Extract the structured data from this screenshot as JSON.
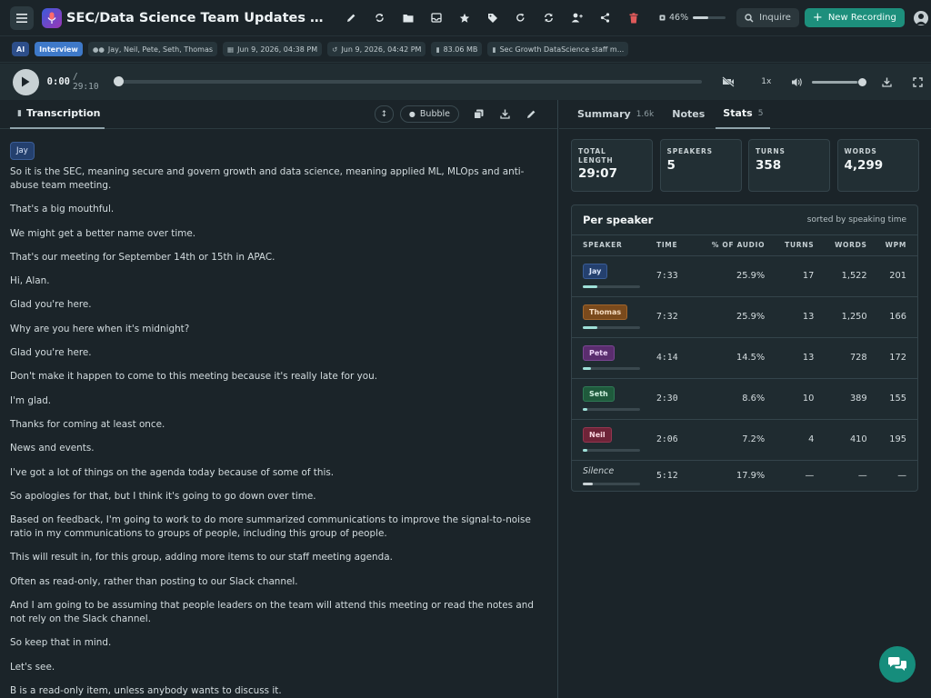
{
  "header": {
    "title": "SEC/Data Science Team Updates and Announcements",
    "toolbar_icons": [
      "pencil-icon",
      "refresh-icon",
      "folder-icon",
      "inbox-icon",
      "star-icon",
      "tag-icon",
      "redo-icon",
      "sync-icon",
      "user-plus-icon",
      "share-icon",
      "trash-icon"
    ],
    "progress_label": "46%",
    "progress_value": 0.46,
    "inquire_label": "Inquire",
    "new_recording_label": "New Recording"
  },
  "meta": {
    "ai_label": "AI",
    "type_label": "Interview",
    "participants": "Jay, Neil, Pete, Seth, Thomas",
    "created": "Jun 9, 2026, 04:38 PM",
    "modified": "Jun 9, 2026, 04:42 PM",
    "size": "83.06 MB",
    "file": "Sec Growth DataScience staff m..."
  },
  "player": {
    "current": "0:00",
    "total": "/ 29:10",
    "position": 0,
    "speed": "1x",
    "volume": 0.9
  },
  "transcript": {
    "tab_label": "Transcription",
    "bubble_label": "Bubble",
    "speaker": "Jay",
    "lines": [
      "So it is the SEC, meaning secure and govern growth and data science, meaning applied ML, MLOps and anti-abuse team meeting.",
      "That's a big mouthful.",
      "We might get a better name over time.",
      "That's our meeting for September 14th or 15th in APAC.",
      "Hi, Alan.",
      "Glad you're here.",
      "Why are you here when it's midnight?",
      "Glad you're here.",
      "Don't make it happen to come to this meeting because it's really late for you.",
      "I'm glad.",
      "Thanks for coming at least once.",
      "News and events.",
      "I've got a lot of things on the agenda today because of some of this.",
      "So apologies for that, but I think it's going to go down over time.",
      "Based on feedback, I'm going to work to do more summarized communications to improve the signal-to-noise ratio in my communications to groups of people, including this group of people.",
      "This will result in, for this group, adding more items to our staff meeting agenda.",
      "Often as read-only, rather than posting to our Slack channel.",
      "And I am going to be assuming that people leaders on the team will attend this meeting or read the notes and not rely on the Slack channel.",
      "So keep that in mind.",
      "Let's see.",
      "B is a read-only item, unless anybody wants to discuss it."
    ]
  },
  "right_tabs": {
    "summary": "Summary",
    "summary_count": "1.6k",
    "notes": "Notes",
    "stats": "Stats",
    "stats_count": "5"
  },
  "stats": {
    "total_length_label": "TOTAL LENGTH",
    "total_length": "29:07",
    "speakers_label": "SPEAKERS",
    "speakers": "5",
    "turns_label": "TURNS",
    "turns": "358",
    "words_label": "WORDS",
    "words": "4,299"
  },
  "per_speaker": {
    "title": "Per speaker",
    "subtitle": "sorted by speaking time",
    "headers": [
      "SPEAKER",
      "TIME",
      "% OF AUDIO",
      "TURNS",
      "WORDS",
      "WPM"
    ],
    "rows": [
      {
        "name": "Jay",
        "time": "7:33",
        "pct": "25.9%",
        "share": 0.259,
        "turns": "17",
        "words": "1,522",
        "wpm": "201",
        "bg": "#24406e",
        "border": "#3a5d96",
        "fg": "#dbe6fb"
      },
      {
        "name": "Thomas",
        "time": "7:32",
        "pct": "25.9%",
        "share": 0.259,
        "turns": "13",
        "words": "1,250",
        "wpm": "166",
        "bg": "#7a4a1c",
        "border": "#a0652c",
        "fg": "#f6dcc0"
      },
      {
        "name": "Pete",
        "time": "4:14",
        "pct": "14.5%",
        "share": 0.145,
        "turns": "13",
        "words": "728",
        "wpm": "172",
        "bg": "#5a2d6e",
        "border": "#7a4592",
        "fg": "#efd6fa"
      },
      {
        "name": "Seth",
        "time": "2:30",
        "pct": "8.6%",
        "share": 0.086,
        "turns": "10",
        "words": "389",
        "wpm": "155",
        "bg": "#1f5a3c",
        "border": "#2f7a55",
        "fg": "#d2f3e1"
      },
      {
        "name": "Neil",
        "time": "2:06",
        "pct": "7.2%",
        "share": 0.072,
        "turns": "4",
        "words": "410",
        "wpm": "195",
        "bg": "#6e2438",
        "border": "#943650",
        "fg": "#fad6df"
      }
    ],
    "silence": {
      "name": "Silence",
      "time": "5:12",
      "pct": "17.9%",
      "share": 0.179,
      "turns": "—",
      "words": "—",
      "wpm": "—"
    }
  },
  "colors": {
    "accent": "#1d8f7c",
    "danger": "#e05a5a",
    "speaker_bar": "#9fe0d8"
  }
}
